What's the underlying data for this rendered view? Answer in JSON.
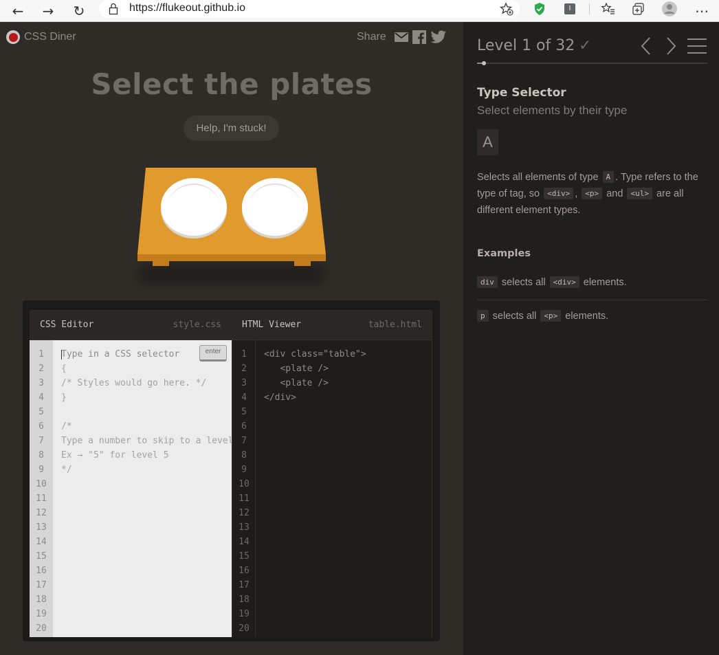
{
  "browser": {
    "url": "https://flukeout.github.io",
    "back_icon": "←",
    "forward_icon": "→",
    "reload_icon": "↻",
    "more_icon": "⋯",
    "extension_label": "I"
  },
  "game": {
    "logo_text": "CSS Diner",
    "share_label": "Share",
    "level_title": "Select the plates",
    "help_label": "Help, I'm stuck!"
  },
  "editor": {
    "css_title": "CSS Editor",
    "css_file": "style.css",
    "html_title": "HTML Viewer",
    "html_file": "table.html",
    "enter_label": "enter",
    "line_numbers": [
      "1",
      "2",
      "3",
      "4",
      "5",
      "6",
      "7",
      "8",
      "9",
      "10",
      "11",
      "12",
      "13",
      "14",
      "15",
      "16",
      "17",
      "18",
      "19",
      "20"
    ],
    "css_lines": [
      "Type in a CSS selector",
      "{",
      "/* Styles would go here. */",
      "}",
      "",
      "/*",
      "Type a number to skip to a level.",
      "Ex → \"5\" for level 5",
      "*/"
    ],
    "html_lines": [
      "<div class=\"table\">",
      "   <plate />",
      "   <plate />",
      "</div>"
    ]
  },
  "sidebar": {
    "level_text": "Level 1 of 32",
    "level_current": 1,
    "level_total": 32,
    "check": "✓",
    "selector_name": "Type Selector",
    "title": "Select elements by their type",
    "syntax": "A",
    "hint": {
      "p1": "Selects all elements of type",
      "tag1": "A",
      "p2": ". Type refers to the type of tag, so",
      "tag2": "<div>",
      "p3": ",",
      "tag3": "<p>",
      "p4": "and",
      "tag4": "<ul>",
      "p5": "are all different element types."
    },
    "examples_label": "Examples",
    "examples": [
      {
        "code": "div",
        "mid": "selects all",
        "tag": "<div>",
        "end": "elements."
      },
      {
        "code": "p",
        "mid": "selects all",
        "tag": "<p>",
        "end": "elements."
      }
    ]
  },
  "colors": {
    "table": "#e09a2e",
    "table_side": "#c47d1c",
    "accent_red": "#b3181b"
  }
}
